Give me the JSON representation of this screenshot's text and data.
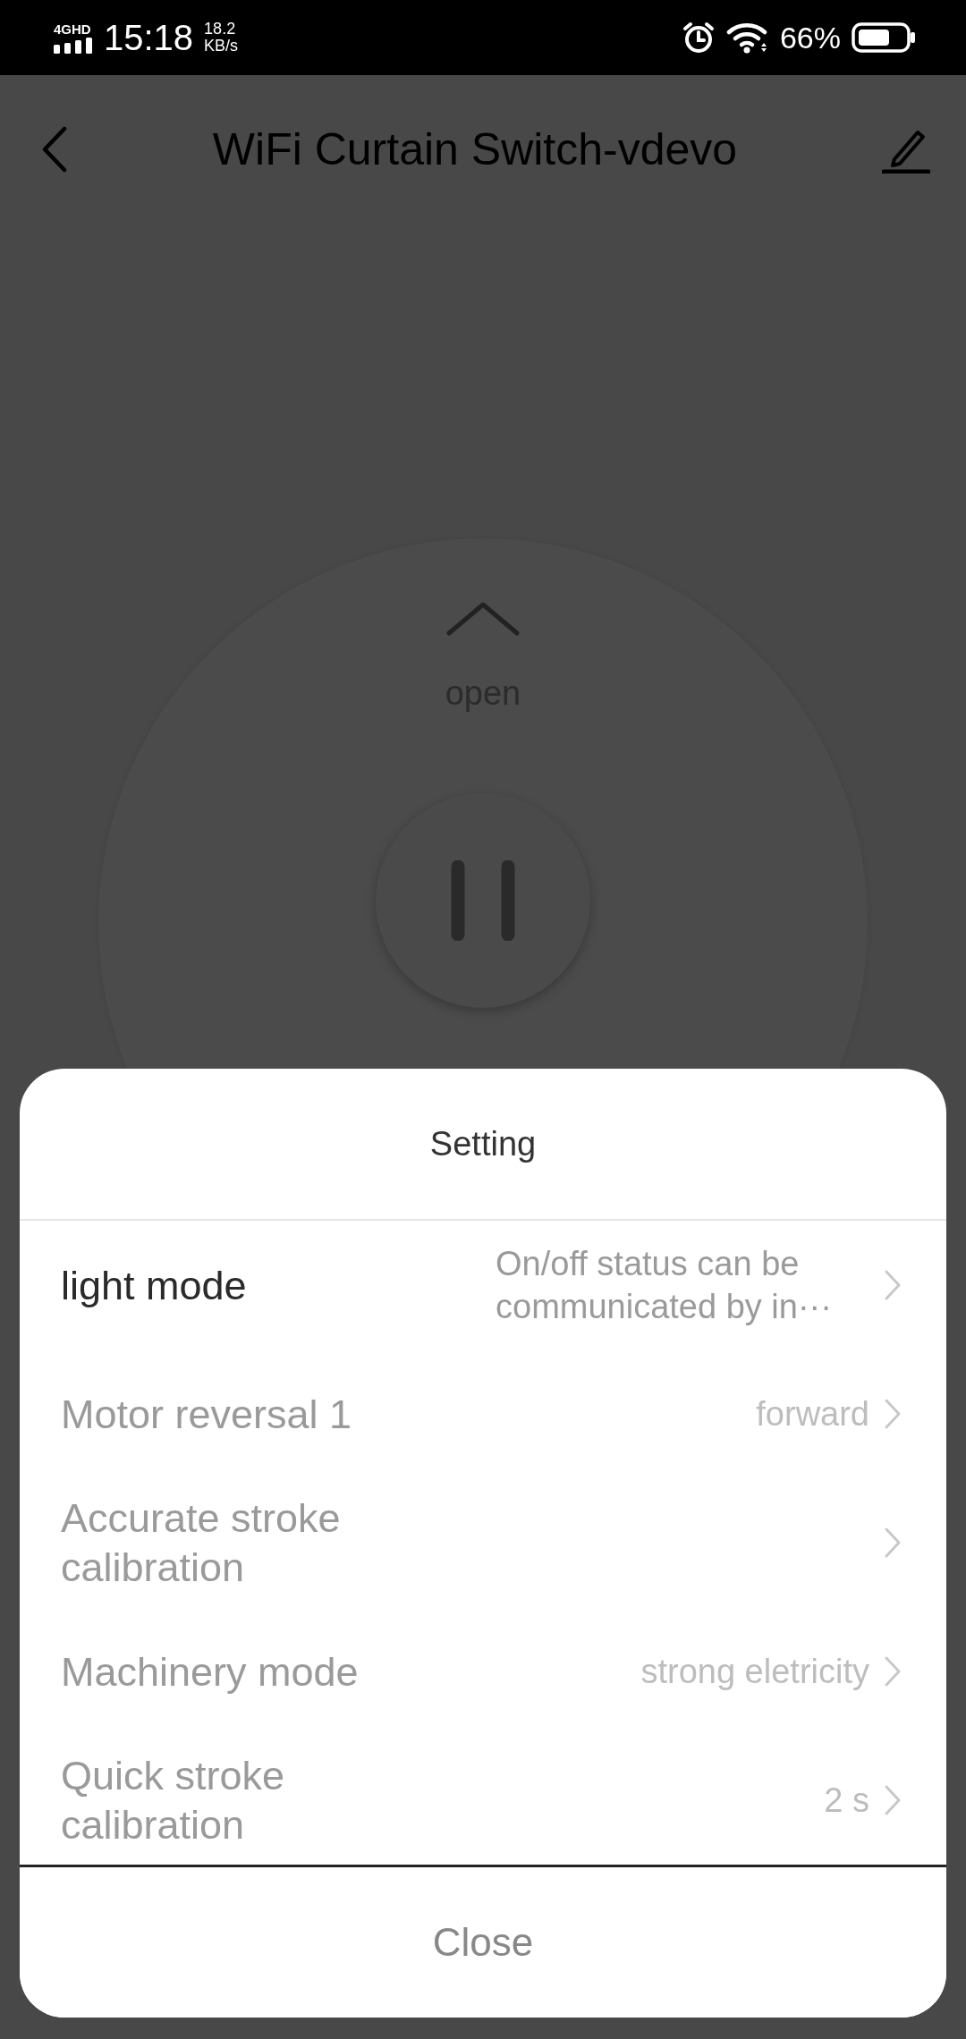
{
  "status_bar": {
    "network": "4GHD",
    "time": "15:18",
    "speed": "18.2",
    "speed_unit": "KB/s",
    "battery": "66%"
  },
  "header": {
    "title": "WiFi Curtain Switch-vdevo"
  },
  "control": {
    "open_label": "open"
  },
  "sheet": {
    "title": "Setting",
    "items": [
      {
        "label": "light mode",
        "value": "On/off status can be communicated by in···",
        "disabled": false
      },
      {
        "label": "Motor reversal 1",
        "value": "forward",
        "disabled": true
      },
      {
        "label": "Accurate stroke calibration",
        "disabled": true
      },
      {
        "label": "Machinery mode",
        "value": "strong eletricity",
        "disabled": true
      },
      {
        "label": "Quick stroke calibration",
        "value": "2 s",
        "disabled": true
      }
    ],
    "close": "Close"
  }
}
